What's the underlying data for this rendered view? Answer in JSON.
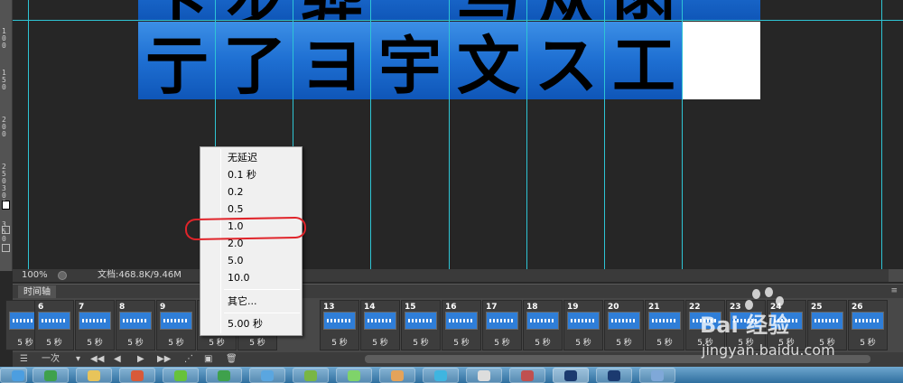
{
  "ruler": {
    "labels": [
      "1",
      "0",
      "0",
      "1",
      "5",
      "0",
      "2",
      "0",
      "0",
      "2",
      "5",
      "0",
      "3",
      "0",
      "0",
      "3",
      "5",
      "0"
    ]
  },
  "canvas": {
    "row1_glyphs": [
      "卞",
      "步",
      "骅",
      "",
      "马",
      "从",
      "函",
      ""
    ],
    "row2_glyphs": [
      "亍",
      "了",
      "ヨ",
      "宇",
      "文",
      "ス",
      "工",
      ""
    ]
  },
  "status": {
    "zoom": "100%",
    "doc": "文档:468.8K/9.46M"
  },
  "timeline": {
    "tab": "时间轴",
    "frames": [
      {
        "num": "",
        "delay": "5 秒"
      },
      {
        "num": "6",
        "delay": "5 秒"
      },
      {
        "num": "7",
        "delay": "5 秒"
      },
      {
        "num": "8",
        "delay": "5 秒"
      },
      {
        "num": "9",
        "delay": "5 秒"
      },
      {
        "num": "",
        "delay": "5 秒"
      },
      {
        "num": "",
        "delay": "5 秒"
      },
      {
        "num": "13",
        "delay": "5 秒"
      },
      {
        "num": "14",
        "delay": "5 秒"
      },
      {
        "num": "15",
        "delay": "5 秒"
      },
      {
        "num": "16",
        "delay": "5 秒"
      },
      {
        "num": "17",
        "delay": "5 秒"
      },
      {
        "num": "18",
        "delay": "5 秒"
      },
      {
        "num": "19",
        "delay": "5 秒"
      },
      {
        "num": "20",
        "delay": "5 秒"
      },
      {
        "num": "21",
        "delay": "5 秒"
      },
      {
        "num": "22",
        "delay": "5 秒"
      },
      {
        "num": "23",
        "delay": "5 秒"
      },
      {
        "num": "24",
        "delay": "5 秒"
      },
      {
        "num": "25",
        "delay": "5 秒"
      },
      {
        "num": "26",
        "delay": "5 秒"
      }
    ],
    "loop": "一次"
  },
  "context_menu": {
    "items": [
      "无延迟",
      "0.1 秒",
      "0.2",
      "0.5",
      "1.0",
      "2.0",
      "5.0",
      "10.0",
      "其它...",
      "5.00 秒"
    ],
    "highlighted": "1.0"
  },
  "watermark": {
    "brand": "Bai 经验",
    "url": "jingyan.baidu.com"
  }
}
